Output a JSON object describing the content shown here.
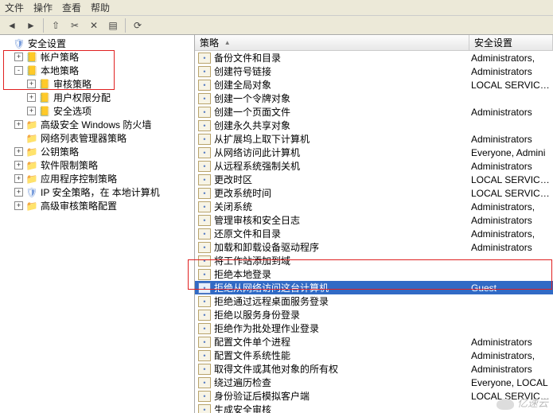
{
  "menu": {
    "items": [
      "文件",
      "操作",
      "查看",
      "帮助"
    ]
  },
  "toolbar": {
    "icons": [
      "back-icon",
      "forward-icon",
      "up-icon",
      "spacer",
      "cut-icon",
      "delete-icon",
      "properties-icon",
      "refresh-icon",
      "help-icon"
    ]
  },
  "tree": [
    {
      "depth": 0,
      "exp": "",
      "icon": "shield",
      "label": "安全设置"
    },
    {
      "depth": 1,
      "exp": "+",
      "icon": "book",
      "label": "帐户策略"
    },
    {
      "depth": 1,
      "exp": "-",
      "icon": "book",
      "label": "本地策略"
    },
    {
      "depth": 2,
      "exp": "+",
      "icon": "book",
      "label": "审核策略"
    },
    {
      "depth": 2,
      "exp": "+",
      "icon": "book",
      "label": "用户权限分配"
    },
    {
      "depth": 2,
      "exp": "+",
      "icon": "book",
      "label": "安全选项"
    },
    {
      "depth": 1,
      "exp": "+",
      "icon": "folder",
      "label": "高级安全 Windows 防火墙"
    },
    {
      "depth": 1,
      "exp": "",
      "icon": "folder",
      "label": "网络列表管理器策略"
    },
    {
      "depth": 1,
      "exp": "+",
      "icon": "folder",
      "label": "公钥策略"
    },
    {
      "depth": 1,
      "exp": "+",
      "icon": "folder",
      "label": "软件限制策略"
    },
    {
      "depth": 1,
      "exp": "+",
      "icon": "folder",
      "label": "应用程序控制策略"
    },
    {
      "depth": 1,
      "exp": "+",
      "icon": "shield",
      "label": "IP 安全策略，在 本地计算机"
    },
    {
      "depth": 1,
      "exp": "+",
      "icon": "folder",
      "label": "高级审核策略配置"
    }
  ],
  "columns": {
    "policy": "策略",
    "setting": "安全设置"
  },
  "rows": [
    {
      "p": "备份文件和目录",
      "s": "Administrators,"
    },
    {
      "p": "创建符号链接",
      "s": "Administrators"
    },
    {
      "p": "创建全局对象",
      "s": "LOCAL SERVICE, N"
    },
    {
      "p": "创建一个令牌对象",
      "s": ""
    },
    {
      "p": "创建一个页面文件",
      "s": "Administrators"
    },
    {
      "p": "创建永久共享对象",
      "s": ""
    },
    {
      "p": "从扩展坞上取下计算机",
      "s": "Administrators"
    },
    {
      "p": "从网络访问此计算机",
      "s": "Everyone, Admini"
    },
    {
      "p": "从远程系统强制关机",
      "s": "Administrators"
    },
    {
      "p": "更改时区",
      "s": "LOCAL SERVICE, A"
    },
    {
      "p": "更改系统时间",
      "s": "LOCAL SERVICE, A"
    },
    {
      "p": "关闭系统",
      "s": "Administrators,"
    },
    {
      "p": "管理审核和安全日志",
      "s": "Administrators"
    },
    {
      "p": "还原文件和目录",
      "s": "Administrators,"
    },
    {
      "p": "加载和卸载设备驱动程序",
      "s": "Administrators"
    },
    {
      "p": "将工作站添加到域",
      "s": ""
    },
    {
      "p": "拒绝本地登录",
      "s": ""
    },
    {
      "p": "拒绝从网络访问这台计算机",
      "s": "Guest",
      "selected": true
    },
    {
      "p": "拒绝通过远程桌面服务登录",
      "s": ""
    },
    {
      "p": "拒绝以服务身份登录",
      "s": ""
    },
    {
      "p": "拒绝作为批处理作业登录",
      "s": ""
    },
    {
      "p": "配置文件单个进程",
      "s": "Administrators"
    },
    {
      "p": "配置文件系统性能",
      "s": "Administrators,"
    },
    {
      "p": "取得文件或其他对象的所有权",
      "s": "Administrators"
    },
    {
      "p": "绕过遍历检查",
      "s": "Everyone, LOCAL"
    },
    {
      "p": "身份验证后模拟客户端",
      "s": "LOCAL SERVICE, N"
    },
    {
      "p": "生成安全审核",
      "s": ""
    }
  ],
  "watermark": "亿速云"
}
